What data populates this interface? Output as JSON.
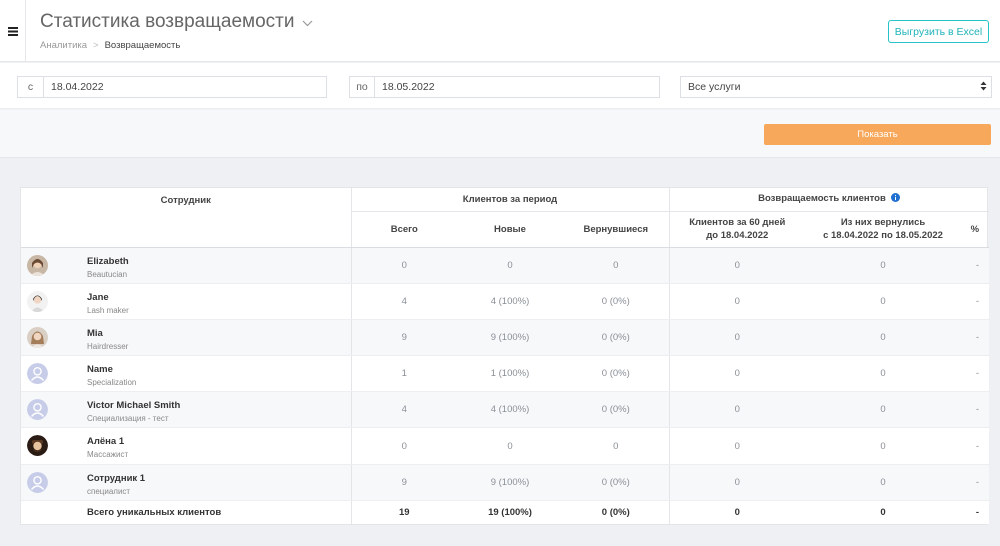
{
  "header": {
    "title": "Статистика возвращаемости",
    "breadcrumb": {
      "parent": "Аналитика",
      "separator": ">",
      "current": "Возвращаемость"
    },
    "export_label": "Выгрузить в Excel"
  },
  "filters": {
    "from": {
      "prefix": "с",
      "value": "18.04.2022"
    },
    "to": {
      "prefix": "по",
      "value": "18.05.2022"
    },
    "services": {
      "value": "Все услуги"
    }
  },
  "actions": {
    "show_label": "Показать"
  },
  "table": {
    "group_headers": {
      "employee": "Сотрудник",
      "period": "Клиентов за период",
      "retention": "Возвращаемость клиентов"
    },
    "columns": {
      "total": "Всего",
      "new": "Новые",
      "returned": "Вернувшиеся",
      "clients60_line1": "Клиентов за 60 дней",
      "clients60_line2": "до 18.04.2022",
      "came_back_line1": "Из них вернулись",
      "came_back_line2": "с 18.04.2022 по 18.05.2022",
      "percent": "%"
    },
    "rows": [
      {
        "name": "Elizabeth",
        "spec": "Beautucian",
        "avatar": "photo-woman-icon",
        "total": "0",
        "new": "0",
        "returned": "0",
        "c60": "0",
        "back": "0",
        "pct": "-"
      },
      {
        "name": "Jane",
        "spec": "Lash maker",
        "avatar": "photo-woman-icon",
        "total": "4",
        "new": "4 (100%)",
        "returned": "0 (0%)",
        "c60": "0",
        "back": "0",
        "pct": "-"
      },
      {
        "name": "Mia",
        "spec": "Hairdresser",
        "avatar": "photo-woman-icon",
        "total": "9",
        "new": "9 (100%)",
        "returned": "0 (0%)",
        "c60": "0",
        "back": "0",
        "pct": "-"
      },
      {
        "name": "Name",
        "spec": "Specialization",
        "avatar": "default-user-icon",
        "total": "1",
        "new": "1 (100%)",
        "returned": "0 (0%)",
        "c60": "0",
        "back": "0",
        "pct": "-"
      },
      {
        "name": "Victor Michael Smith",
        "spec": "Специализация - тест",
        "avatar": "default-user-icon",
        "total": "4",
        "new": "4 (100%)",
        "returned": "0 (0%)",
        "c60": "0",
        "back": "0",
        "pct": "-"
      },
      {
        "name": "Алёна 1",
        "spec": "Массажист",
        "avatar": "photo-man-icon",
        "total": "0",
        "new": "0",
        "returned": "0",
        "c60": "0",
        "back": "0",
        "pct": "-"
      },
      {
        "name": "Сотрудник 1",
        "spec": "специалист",
        "avatar": "default-user-icon",
        "total": "9",
        "new": "9 (100%)",
        "returned": "0 (0%)",
        "c60": "0",
        "back": "0",
        "pct": "-"
      }
    ],
    "total_row": {
      "label": "Всего уникальных клиентов",
      "total": "19",
      "new": "19 (100%)",
      "returned": "0 (0%)",
      "c60": "0",
      "back": "0",
      "pct": "-"
    }
  },
  "colors": {
    "accent_teal": "#27c3c9",
    "button_orange": "#f7a85a",
    "info_blue": "#1f6fd1"
  }
}
